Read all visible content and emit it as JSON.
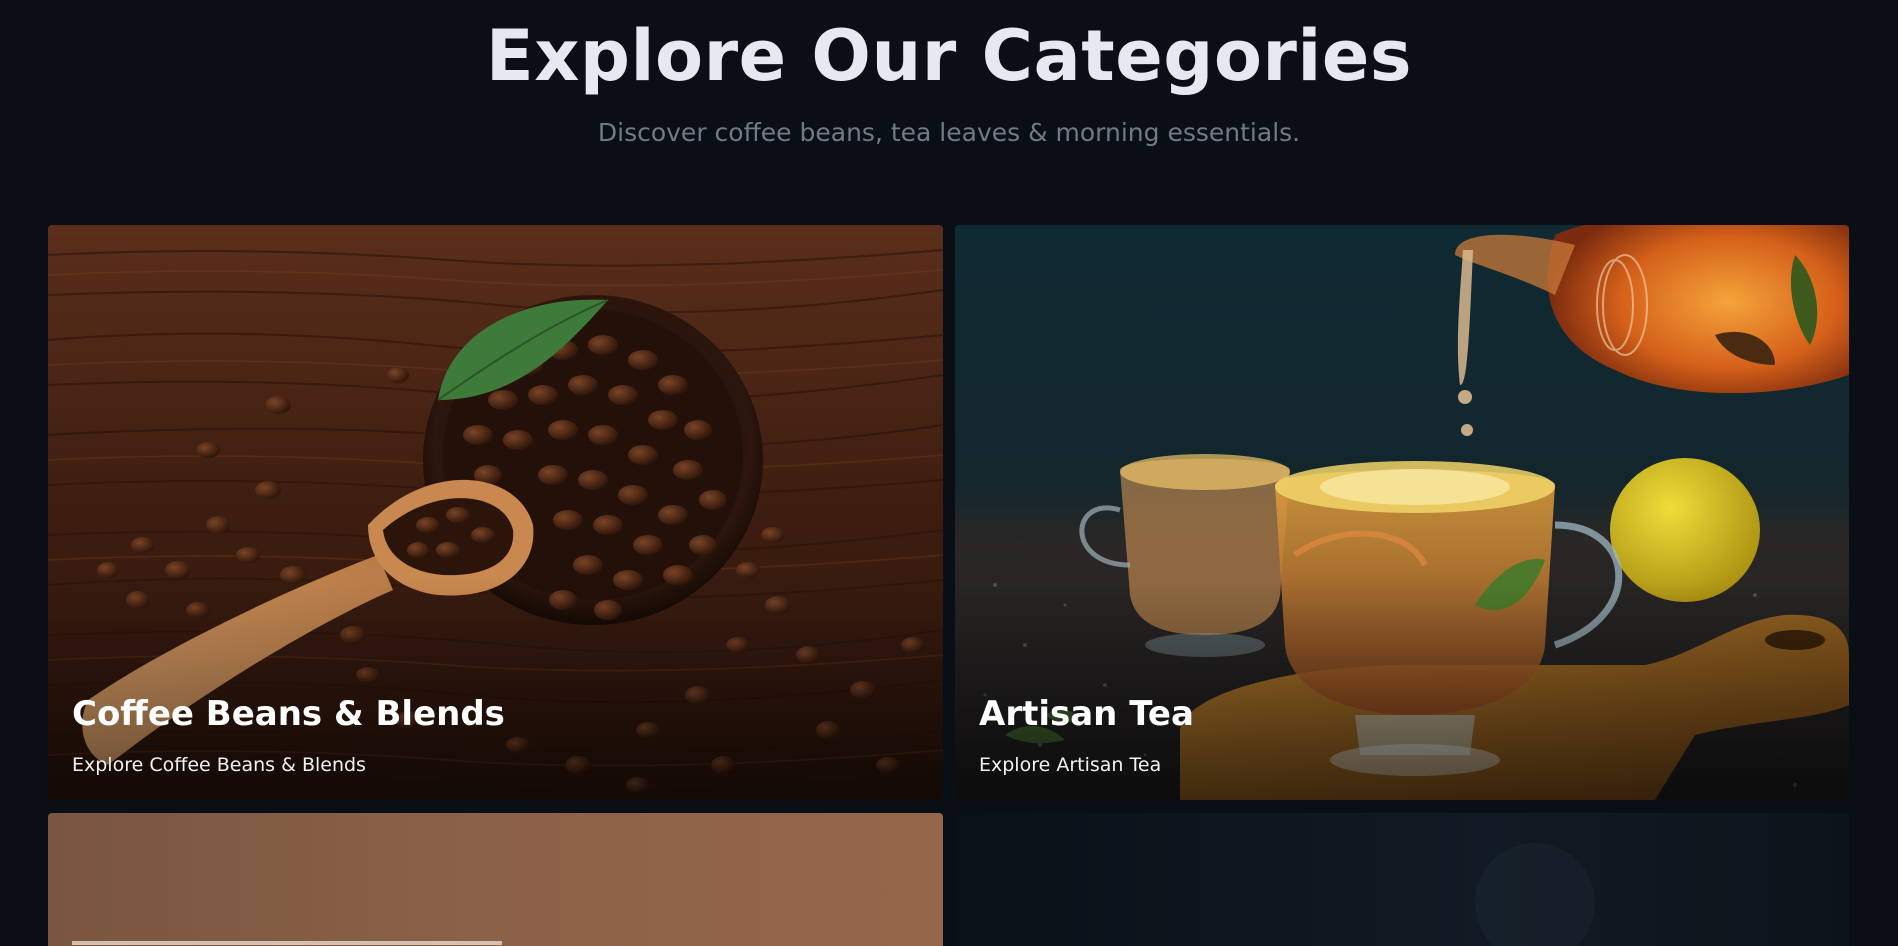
{
  "header": {
    "title": "Explore Our Categories",
    "subtitle": "Discover coffee beans, tea leaves & morning essentials."
  },
  "categories": [
    {
      "title": "Coffee Beans & Blends",
      "link_text": "Explore Coffee Beans & Blends",
      "image": "coffee-beans-in-bowl-with-wooden-scoop"
    },
    {
      "title": "Artisan Tea",
      "link_text": "Explore Artisan Tea",
      "image": "tea-poured-into-glass-cups-with-lemon"
    },
    {
      "image": "warm-brown-backdrop"
    },
    {
      "image": "dark-navy-backdrop"
    }
  ],
  "colors": {
    "background": "#0a0e15",
    "heading": "#e6e9ef",
    "subtitle": "#727a88",
    "card_text": "#ffffff"
  }
}
